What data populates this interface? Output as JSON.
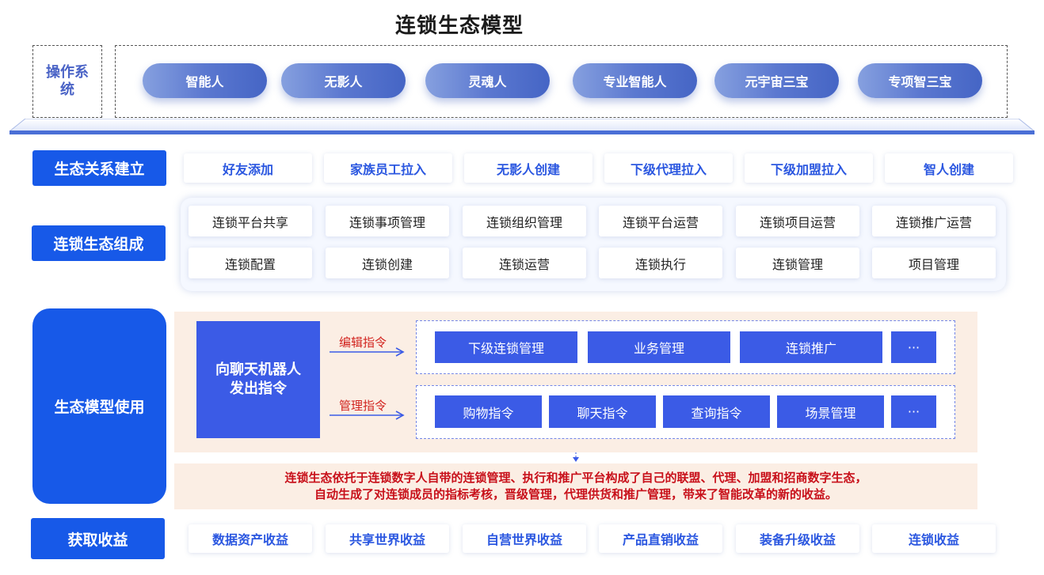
{
  "title": "连锁生态模型",
  "os": {
    "label": "操作系统",
    "items": [
      "智能人",
      "无影人",
      "灵魂人",
      "专业智能人",
      "元宇宙三宝",
      "专项智三宝"
    ]
  },
  "relation": {
    "label": "生态关系建立",
    "items": [
      "好友添加",
      "家族员工拉入",
      "无影人创建",
      "下级代理拉入",
      "下级加盟拉入",
      "智人创建"
    ]
  },
  "composition": {
    "label": "连锁生态组成",
    "row1": [
      "连锁平台共享",
      "连锁事项管理",
      "连锁组织管理",
      "连锁平台运营",
      "连锁项目运营",
      "连锁推广运营"
    ],
    "row2": [
      "连锁配置",
      "连锁创建",
      "连锁运营",
      "连锁执行",
      "连锁管理",
      "项目管理"
    ]
  },
  "usage": {
    "label": "生态模型使用",
    "chat_box": "向聊天机器人发出指令",
    "edit_label": "编辑指令",
    "manage_label": "管理指令",
    "edit_items": [
      "下级连锁管理",
      "业务管理",
      "连锁推广",
      "···"
    ],
    "manage_items": [
      "购物指令",
      "聊天指令",
      "查询指令",
      "场景管理",
      "···"
    ],
    "summary_line1": "连锁生态依托于连锁数字人自带的连锁管理、执行和推广平台构成了自己的联盟、代理、加盟和招商数字生态，",
    "summary_line2": "自动生成了对连锁成员的指标考核，晋级管理，代理供货和推广管理，带来了智能改革的新的收益。"
  },
  "revenue": {
    "label": "获取收益",
    "items": [
      "数据资产收益",
      "共享世界收益",
      "自营世界收益",
      "产品直销收益",
      "装备升级收益",
      "连锁收益"
    ]
  },
  "colors": {
    "primary_blue": "#1759e8",
    "button_blue": "#3b5be6",
    "accent_red": "#c8101a",
    "peach_bg": "#fbeee4"
  }
}
